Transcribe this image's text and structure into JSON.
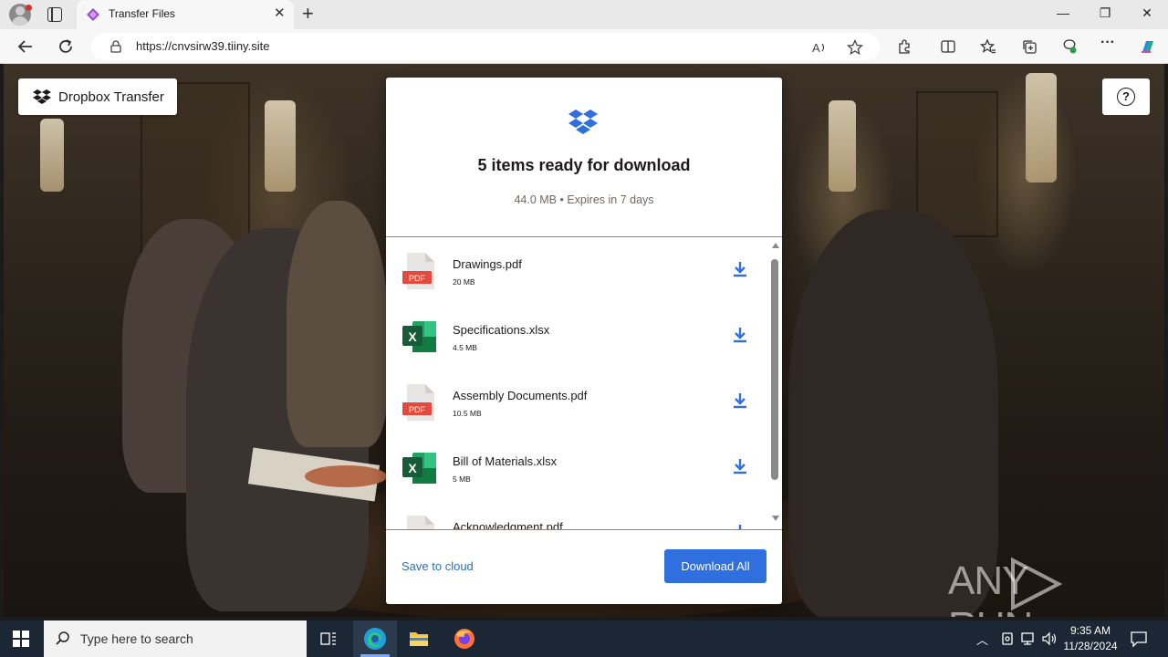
{
  "browser": {
    "tab_title": "Transfer Files",
    "url": "https://cnvsirw39.tiiny.site"
  },
  "page": {
    "brand_label": "Dropbox Transfer",
    "help_label": "?",
    "modal": {
      "title": "5 items ready for download",
      "subtitle": "44.0 MB • Expires in 7 days",
      "files": [
        {
          "name": "Drawings.pdf",
          "size": "20 MB",
          "type": "pdf"
        },
        {
          "name": "Specifications.xlsx",
          "size": "4.5 MB",
          "type": "xlsx"
        },
        {
          "name": "Assembly Documents.pdf",
          "size": "10.5 MB",
          "type": "pdf"
        },
        {
          "name": "Bill of Materials.xlsx",
          "size": "5 MB",
          "type": "xlsx"
        },
        {
          "name": "Acknowledgment.pdf",
          "size": "",
          "type": "pdf"
        }
      ],
      "save_to_cloud_label": "Save to cloud",
      "download_all_label": "Download All"
    },
    "watermark": "ANY RUN"
  },
  "taskbar": {
    "search_placeholder": "Type here to search",
    "time": "9:35 AM",
    "date": "11/28/2024"
  },
  "colors": {
    "accent": "#2f70de",
    "link": "#2f6fb5",
    "pdf_red": "#e24a3b",
    "excel_green": "#1d7044"
  },
  "icons": [
    "profile-icon",
    "tabs-icon",
    "close-icon",
    "new-tab-icon",
    "back-icon",
    "refresh-icon",
    "lock-icon",
    "read-aloud-icon",
    "favorite-icon",
    "extensions-icon",
    "split-screen-icon",
    "favorites-icon",
    "collections-icon",
    "browser-essentials-icon",
    "more-icon",
    "copilot-icon",
    "dropbox-icon",
    "help-icon",
    "pdf-file-icon",
    "excel-file-icon",
    "download-icon",
    "windows-start-icon",
    "search-icon",
    "task-view-icon",
    "edge-icon",
    "file-explorer-icon",
    "firefox-icon",
    "notification-icon"
  ]
}
